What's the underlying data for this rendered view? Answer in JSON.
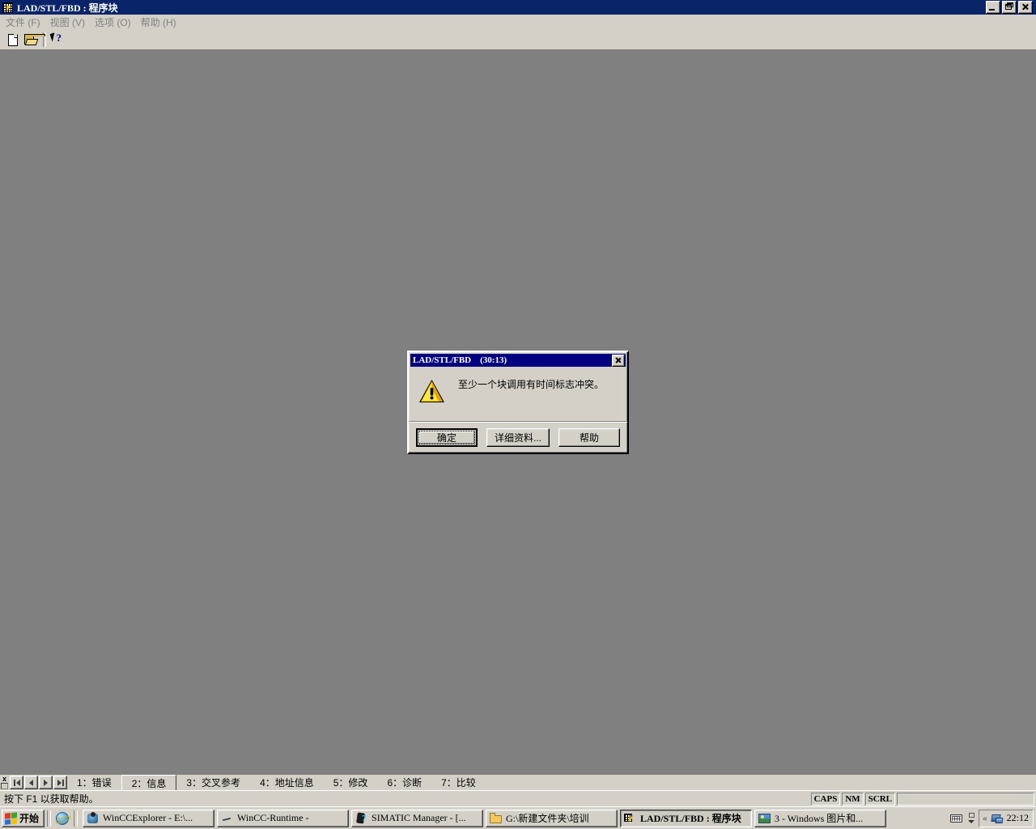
{
  "window": {
    "title": "LAD/STL/FBD : 程序块",
    "icon": "ladder-editor-icon",
    "controls": {
      "minimize": "minimize-icon",
      "restore": "restore-icon",
      "close": "close-icon"
    }
  },
  "menu": {
    "items": [
      {
        "label": "文件 (F)",
        "name": "menu-file"
      },
      {
        "label": "视图 (V)",
        "name": "menu-view"
      },
      {
        "label": "选项 (O)",
        "name": "menu-options"
      },
      {
        "label": "帮助 (H)",
        "name": "menu-help"
      }
    ]
  },
  "toolbar": {
    "buttons": [
      {
        "name": "new-document-button",
        "icon": "new-document-icon"
      },
      {
        "name": "open-file-button",
        "icon": "open-folder-icon"
      },
      {
        "name": "context-help-button",
        "icon": "help-pointer-icon"
      }
    ]
  },
  "tabstrip": {
    "close_label": "x",
    "nav": [
      {
        "name": "tab-nav-first",
        "icon": "first-arrow-icon"
      },
      {
        "name": "tab-nav-prev",
        "icon": "prev-arrow-icon"
      },
      {
        "name": "tab-nav-next",
        "icon": "next-arrow-icon"
      },
      {
        "name": "tab-nav-last",
        "icon": "last-arrow-icon"
      }
    ],
    "tabs": [
      {
        "label": "1：错误",
        "active": false
      },
      {
        "label": "2：信息",
        "active": true
      },
      {
        "label": "3：交叉参考",
        "active": false
      },
      {
        "label": "4：地址信息",
        "active": false
      },
      {
        "label": "5：修改",
        "active": false
      },
      {
        "label": "6：诊断",
        "active": false
      },
      {
        "label": "7：比较",
        "active": false
      }
    ]
  },
  "statusbar": {
    "message": "按下 F1 以获取帮助。",
    "indicators": [
      "CAPS",
      "NM",
      "SCRL"
    ]
  },
  "dialog": {
    "title": "LAD/STL/FBD    (30:13)",
    "close_icon": "close-icon",
    "icon": "warning-triangle-icon",
    "message": "至少一个块调用有时间标志冲突。",
    "buttons": [
      {
        "label": "确定",
        "name": "ok-button",
        "default": true
      },
      {
        "label": "详细资料...",
        "name": "details-button",
        "default": false
      },
      {
        "label": "帮助",
        "name": "help-button",
        "default": false
      }
    ]
  },
  "taskbar": {
    "start_label": "开始",
    "quicklaunch": [
      {
        "name": "quicklaunch-internet-explorer",
        "icon": "internet-explorer-icon"
      }
    ],
    "tasks": [
      {
        "label": "WinCCExplorer - E:\\...",
        "icon": "wincc-explorer-icon",
        "active": false
      },
      {
        "label": "WinCC-Runtime -",
        "icon": "wincc-runtime-icon",
        "active": false
      },
      {
        "label": "SIMATIC Manager - [...",
        "icon": "simatic-manager-icon",
        "active": false
      },
      {
        "label": "G:\\新建文件夹\\培训",
        "icon": "folder-icon",
        "active": false
      },
      {
        "label": "LAD/STL/FBD : 程序块",
        "icon": "ladder-editor-icon",
        "active": true
      },
      {
        "label": "3 - Windows 图片和...",
        "icon": "photo-viewer-icon",
        "active": false
      }
    ],
    "tray": {
      "icons": [
        {
          "name": "keyboard-layout-icon",
          "icon": "keyboard-icon"
        },
        {
          "name": "tray-expand-icon",
          "icon": "expand-icon"
        }
      ],
      "chevron": "«",
      "network_icon": "network-icon",
      "clock": "22:12"
    }
  },
  "colors": {
    "titlebar": "#0a246a",
    "dialog_titlebar": "#000080",
    "face": "#d4d0c8",
    "client": "#808080",
    "warning": "#ffd800"
  }
}
